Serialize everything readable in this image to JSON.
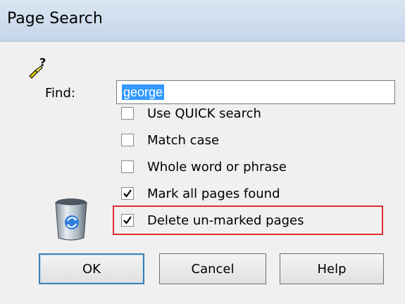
{
  "window": {
    "title": "Page Search"
  },
  "find": {
    "label": "Find:",
    "value": "george"
  },
  "options": [
    {
      "label": "Use QUICK search",
      "checked": false
    },
    {
      "label": "Match case",
      "checked": false
    },
    {
      "label": "Whole word or phrase",
      "checked": false
    },
    {
      "label": "Mark all pages found",
      "checked": true
    },
    {
      "label": "Delete un-marked pages",
      "checked": true
    }
  ],
  "buttons": {
    "ok": "OK",
    "cancel": "Cancel",
    "help": "Help"
  },
  "icons": {
    "help": "help-pointer-icon",
    "recycle": "recycle-bin-icon"
  },
  "colors": {
    "highlight": "#e03030",
    "selection": "#3399ff"
  }
}
